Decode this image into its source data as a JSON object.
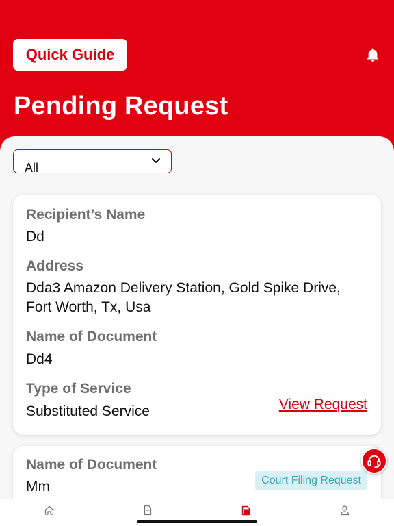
{
  "header": {
    "quick_guide_label": "Quick Guide",
    "title": "Pending Request",
    "bell_icon": "bell-icon"
  },
  "filter": {
    "selected": "All",
    "chevron_icon": "chevron-down-icon"
  },
  "requests": [
    {
      "recipient_label": "Recipient’s Name",
      "recipient": "Dd",
      "address_label": "Address",
      "address": "Dda3 Amazon Delivery Station, Gold Spike Drive, Fort Worth, Tx, Usa",
      "document_label": "Name of Document",
      "document": "Dd4",
      "service_label": "Type of Service",
      "service": "Substituted Service",
      "view_label": "View Request"
    },
    {
      "document_label": "Name of Document",
      "document": "Mm",
      "badge": "Court Filing Request"
    }
  ],
  "support_icon": "headset-icon",
  "tabs": [
    "home-icon",
    "document-icon",
    "requests-icon",
    "profile-icon"
  ],
  "colors": {
    "brand_red": "#e1000f",
    "label_gray": "#6f6f6f",
    "badge_bg": "#d9f1f5",
    "badge_text": "#3aa7bd"
  }
}
